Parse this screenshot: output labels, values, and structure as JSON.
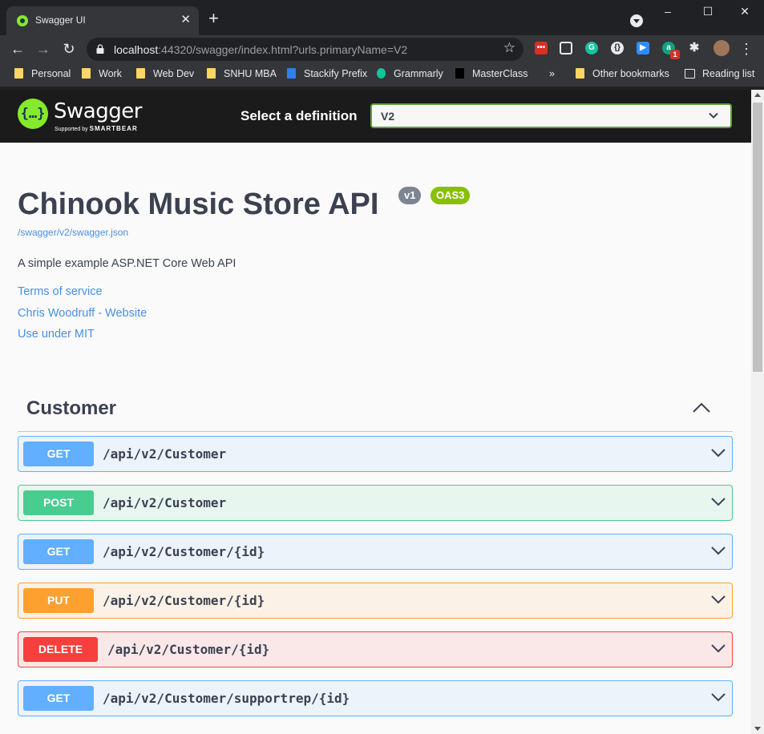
{
  "browser": {
    "tab_title": "Swagger UI",
    "tab_close": "✕",
    "new_tab": "+",
    "url_host": "localhost",
    "url_rest": ":44320/swagger/index.html?urls.primaryName=V2",
    "bookmarks": [
      "Personal",
      "Work",
      "Web Dev",
      "SNHU MBA",
      "Stackify Prefix",
      "Grammarly",
      "MasterClass"
    ],
    "bookmarks_overflow": "»",
    "other_bookmarks": "Other bookmarks",
    "reading_list": "Reading list",
    "ext_badge": "1",
    "window_controls": [
      "–",
      "☐",
      "✕"
    ]
  },
  "swagger": {
    "brand": "Swagger",
    "brand_sub_prefix": "Supported by",
    "brand_sub_company": "SMARTBEAR",
    "select_label": "Select a definition",
    "selected_definition": "V2"
  },
  "info": {
    "title": "Chinook Music Store API",
    "version_badge": "v1",
    "oas_badge": "OAS3",
    "spec_url": "/swagger/v2/swagger.json",
    "description": "A simple example ASP.NET Core Web API",
    "links": [
      "Terms of service",
      "Chris Woodruff - Website",
      "Use under MIT"
    ]
  },
  "tag": {
    "name": "Customer"
  },
  "operations": [
    {
      "method": "GET",
      "path": "/api/v2/Customer"
    },
    {
      "method": "POST",
      "path": "/api/v2/Customer"
    },
    {
      "method": "GET",
      "path": "/api/v2/Customer/{id}"
    },
    {
      "method": "PUT",
      "path": "/api/v2/Customer/{id}"
    },
    {
      "method": "DELETE",
      "path": "/api/v2/Customer/{id}"
    },
    {
      "method": "GET",
      "path": "/api/v2/Customer/supportrep/{id}"
    }
  ],
  "colors": {
    "get": "#61affe",
    "post": "#49cc90",
    "put": "#fca130",
    "delete": "#f93e3e",
    "version_badge": "#7d8492",
    "oas_badge": "#89bf04",
    "brand_green": "#85ea2d"
  }
}
